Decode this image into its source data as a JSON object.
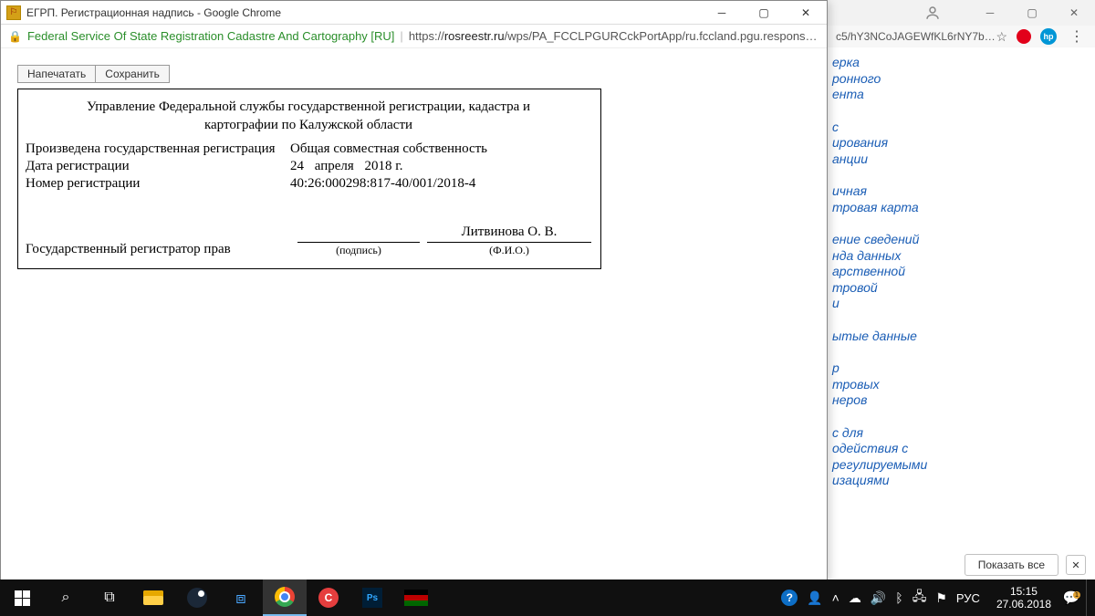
{
  "background": {
    "addr_fragment": "c5/hY3NCoJAGEWfKL6rNY7bQ…",
    "links": [
      [
        "ерка",
        "ронного",
        "ента"
      ],
      [
        "с",
        "ирования",
        "анции"
      ],
      [
        "ичная",
        "тровая карта"
      ],
      [
        "ение сведений",
        "нда данных",
        "арственной",
        "тровой",
        "и"
      ],
      [
        "ытые данные"
      ],
      [
        "р",
        "тровых",
        "неров"
      ],
      [
        "с для",
        "одействия с",
        "регулируемыми",
        "изациями"
      ]
    ],
    "show_all": "Показать все"
  },
  "popup": {
    "title": "ЕГРП. Регистрационная надпись - Google Chrome",
    "cert": "Federal Service Of State Registration Cadastre And Cartography [RU]",
    "url_prefix": "https://",
    "url_host": "rosreestr.ru",
    "url_path": "/wps/PA_FCCLPGURCckPortApp/ru.fccland.pgu.response.check?ru.fcc…",
    "buttons": {
      "print": "Напечатать",
      "save": "Сохранить"
    }
  },
  "doc": {
    "header": "Управление Федеральной службы государственной регистрации, кадастра и картографии по Калужской области",
    "rows": {
      "reg_done_label": "Произведена государственная регистрация",
      "reg_done_value": "Общая совместная собственность",
      "reg_date_label": "Дата регистрации",
      "reg_date_day": "24",
      "reg_date_month": "апреля",
      "reg_date_year": "2018 г.",
      "reg_num_label": "Номер регистрации",
      "reg_num_value": "40:26:000298:817-40/001/2018-4"
    },
    "sig": {
      "role": "Государственный регистратор прав",
      "caption_sign": "(подпись)",
      "name": "Литвинова О. В.",
      "caption_fio": "(Ф.И.О.)"
    }
  },
  "taskbar": {
    "lang": "РУС",
    "time": "15:15",
    "date": "27.06.2018",
    "badge": "1"
  }
}
